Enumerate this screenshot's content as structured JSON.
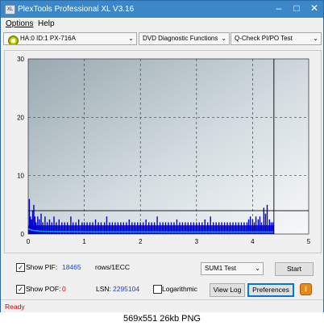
{
  "window": {
    "title": "PlexTools Professional XL V3.16",
    "icon_label": "XL",
    "controls": [
      "minimize-icon",
      "maximize-icon",
      "close-icon"
    ]
  },
  "menu": [
    "Options",
    "Help"
  ],
  "toolbar": {
    "drive": "HA:0 ID:1  PX-716A",
    "function": "DVD Diagnostic Functions",
    "test": "Q-Check PI/PO Test"
  },
  "chart_data": {
    "type": "bar",
    "title": "",
    "xlabel": "",
    "ylabel": "",
    "xlim": [
      0,
      5
    ],
    "ylim": [
      0,
      30
    ],
    "x_ticks": [
      "0",
      "1",
      "2",
      "3",
      "4",
      "5"
    ],
    "y_ticks": [
      "0",
      "10",
      "20",
      "30"
    ],
    "grid": true,
    "end_marker_x": 4.38,
    "threshold_y": 4,
    "series": [
      {
        "color": "#0000cc",
        "x": [
          0.02,
          0.04,
          0.06,
          0.08,
          0.1,
          0.12,
          0.14,
          0.17,
          0.2,
          0.23,
          0.26,
          0.3,
          0.34,
          0.38,
          0.42,
          0.46,
          0.5,
          0.55,
          0.6,
          0.65,
          0.7,
          0.76,
          0.8,
          0.85,
          0.9,
          0.96,
          1.0,
          1.05,
          1.1,
          1.15,
          1.2,
          1.25,
          1.3,
          1.36,
          1.4,
          1.45,
          1.5,
          1.55,
          1.6,
          1.65,
          1.7,
          1.75,
          1.8,
          1.85,
          1.9,
          1.95,
          2.0,
          2.05,
          2.1,
          2.15,
          2.2,
          2.25,
          2.3,
          2.35,
          2.4,
          2.45,
          2.5,
          2.55,
          2.6,
          2.65,
          2.7,
          2.75,
          2.8,
          2.85,
          2.9,
          2.95,
          3.0,
          3.05,
          3.1,
          3.15,
          3.2,
          3.25,
          3.3,
          3.35,
          3.4,
          3.45,
          3.5,
          3.55,
          3.6,
          3.65,
          3.7,
          3.75,
          3.8,
          3.85,
          3.9,
          3.93,
          3.96,
          4.0,
          4.03,
          4.06,
          4.1,
          4.13,
          4.16,
          4.2,
          4.23,
          4.26,
          4.3,
          4.33,
          4.36
        ],
        "values": [
          6,
          3,
          2.5,
          4,
          5,
          3,
          2,
          3,
          2.5,
          3.5,
          2,
          3,
          2,
          2.5,
          2,
          3,
          2,
          2.5,
          2,
          2,
          2,
          3,
          2,
          2,
          2.5,
          2,
          2,
          2,
          2,
          2,
          2.5,
          2,
          2,
          2,
          3,
          2,
          2,
          2,
          2,
          2,
          2,
          2,
          2.5,
          2,
          2,
          2,
          2,
          2,
          2.5,
          2,
          2,
          2,
          3,
          2,
          2,
          2,
          2,
          2,
          2,
          2.5,
          2,
          2,
          2,
          2,
          2,
          2,
          2,
          2,
          2,
          2.5,
          2,
          3,
          2,
          2,
          2,
          2,
          2,
          2,
          2,
          2,
          2,
          2,
          2,
          2,
          2,
          2.5,
          3,
          2.5,
          2,
          3,
          2.5,
          3,
          2,
          4.5,
          3.5,
          5,
          2.5,
          2,
          2
        ]
      },
      {
        "color": "#00a0e0",
        "x": [
          0,
          0.05,
          0.1,
          0.2,
          0.3,
          0.5,
          0.8,
          1.2,
          1.6,
          2.0,
          2.5,
          3.0,
          3.5,
          4.0,
          4.38
        ],
        "values": [
          0.9,
          0.7,
          0.6,
          0.5,
          0.45,
          0.4,
          0.38,
          0.36,
          0.35,
          0.35,
          0.34,
          0.34,
          0.34,
          0.34,
          0.34
        ]
      }
    ]
  },
  "controls": {
    "show_pif_label": "Show PIF:",
    "pif_value": "18465",
    "rows_label": "rows/1ECC",
    "show_pof_label": "Show POF:",
    "pof_value": "0",
    "lsn_label": "LSN:",
    "lsn_value": "2295104",
    "logarithmic_label": "Logarithmic",
    "mode_select": "SUM1 Test",
    "start_label": "Start",
    "view_log_label": "View Log",
    "preferences_label": "Preferences",
    "info_label": "i"
  },
  "status": {
    "text": "Ready",
    "color": "#cc0000"
  },
  "caption": "569x551 26kb PNG"
}
